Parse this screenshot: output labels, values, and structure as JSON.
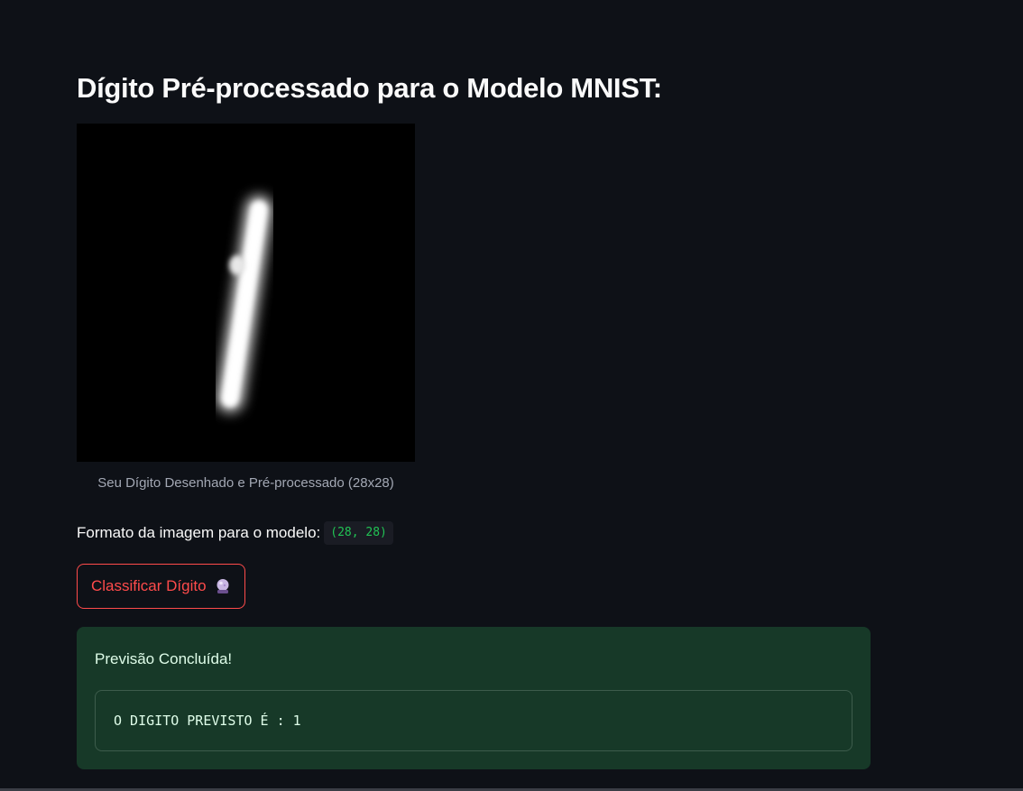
{
  "heading": "Dígito Pré-processado para o Modelo MNIST:",
  "image": {
    "caption": "Seu Dígito Desenhado e Pré-processado (28x28)",
    "shown_digit": "1"
  },
  "format": {
    "label": "Formato da imagem para o modelo:",
    "value": "(28, 28)"
  },
  "classify_button": {
    "label": "Classificar Dígito",
    "icon": "crystal-ball-icon"
  },
  "result": {
    "title": "Previsão Concluída!",
    "code": "O DIGITO PREVISTO É : 1"
  },
  "colors": {
    "background": "#0e1117",
    "accent": "#ff4b4b",
    "success_bg": "#173928",
    "code_green": "#21c354"
  }
}
